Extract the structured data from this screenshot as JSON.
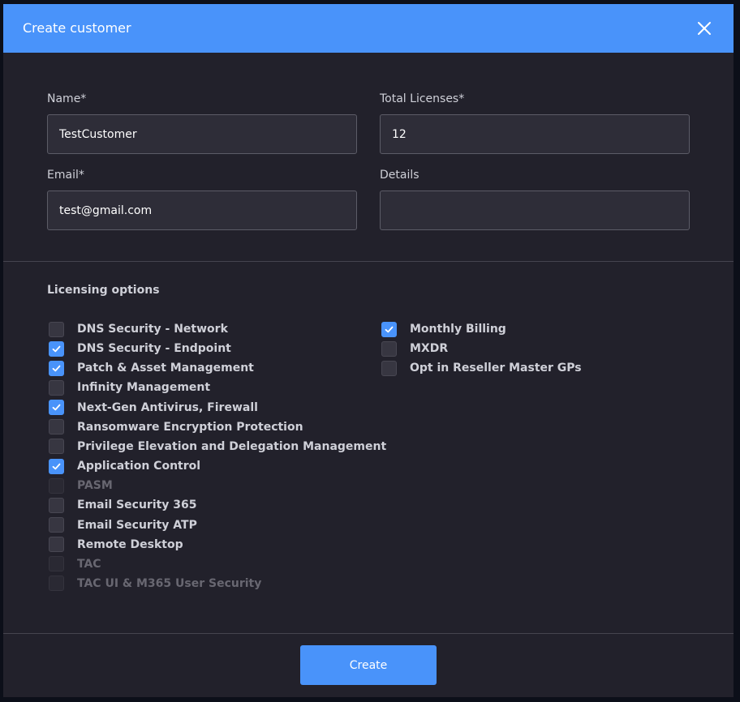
{
  "dialog": {
    "title": "Create customer",
    "close_icon": "close-icon"
  },
  "form": {
    "name": {
      "label": "Name*",
      "value": "TestCustomer"
    },
    "total_licenses": {
      "label": "Total Licenses*",
      "value": "12"
    },
    "email": {
      "label": "Email*",
      "value": "test@gmail.com"
    },
    "details": {
      "label": "Details",
      "value": ""
    }
  },
  "licensing": {
    "title": "Licensing options",
    "left": [
      {
        "label": "DNS Security - Network",
        "checked": false,
        "disabled": false
      },
      {
        "label": "DNS Security - Endpoint",
        "checked": true,
        "disabled": false
      },
      {
        "label": "Patch & Asset Management",
        "checked": true,
        "disabled": false
      },
      {
        "label": "Infinity Management",
        "checked": false,
        "disabled": false
      },
      {
        "label": "Next-Gen Antivirus, Firewall",
        "checked": true,
        "disabled": false
      },
      {
        "label": "Ransomware Encryption Protection",
        "checked": false,
        "disabled": false
      },
      {
        "label": "Privilege Elevation and Delegation Management",
        "checked": false,
        "disabled": false
      },
      {
        "label": "Application Control",
        "checked": true,
        "disabled": false
      },
      {
        "label": "PASM",
        "checked": false,
        "disabled": true
      },
      {
        "label": "Email Security 365",
        "checked": false,
        "disabled": false
      },
      {
        "label": "Email Security ATP",
        "checked": false,
        "disabled": false
      },
      {
        "label": "Remote Desktop",
        "checked": false,
        "disabled": false
      },
      {
        "label": "TAC",
        "checked": false,
        "disabled": true
      },
      {
        "label": "TAC UI & M365 User Security",
        "checked": false,
        "disabled": true
      }
    ],
    "right": [
      {
        "label": "Monthly Billing",
        "checked": true,
        "disabled": false
      },
      {
        "label": "MXDR",
        "checked": false,
        "disabled": false
      },
      {
        "label": "Opt in Reseller Master GPs",
        "checked": false,
        "disabled": false
      }
    ]
  },
  "footer": {
    "create_label": "Create"
  },
  "colors": {
    "accent": "#4993fa",
    "panel": "#22212b",
    "input_bg": "#2e2d38",
    "text": "#cfd0d8",
    "disabled_text": "#686771"
  }
}
